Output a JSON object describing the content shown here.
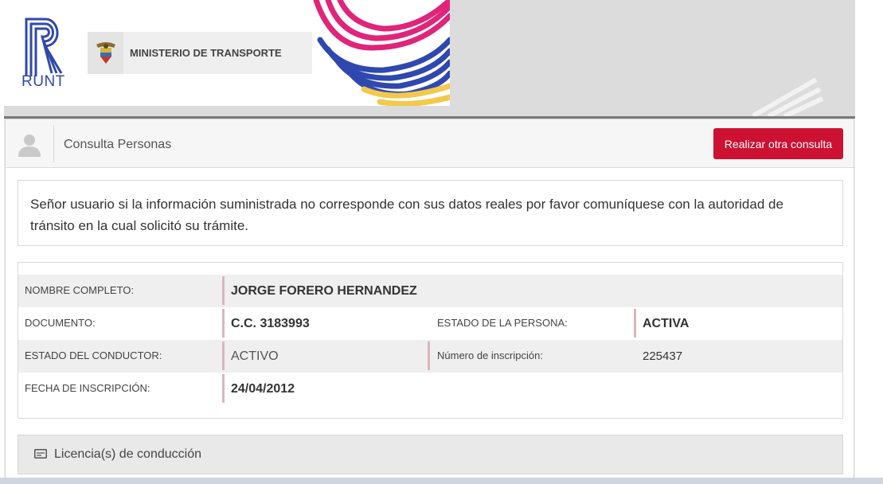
{
  "header": {
    "logo_text": "RUNT",
    "ministry_name": "MINISTERIO DE TRANSPORTE"
  },
  "panel": {
    "title": "Consulta Personas",
    "requery_button": "Realizar otra consulta"
  },
  "notice": {
    "text": "Señor usuario si la información suministrada no corresponde con sus datos reales por favor comuníquese con la autoridad de tránsito en la cual solicitó su trámite."
  },
  "person": {
    "full_name_label": "NOMBRE COMPLETO:",
    "full_name": "JORGE FORERO HERNANDEZ",
    "document_label": "DOCUMENTO:",
    "document": "C.C. 3183993",
    "person_status_label": "ESTADO DE LA PERSONA:",
    "person_status": "ACTIVA",
    "driver_status_label": "ESTADO DEL CONDUCTOR:",
    "driver_status": "ACTIVO",
    "registration_number_label": "Número de inscripción:",
    "registration_number": "225437",
    "registration_date_label": "FECHA DE INSCRIPCIÓN:",
    "registration_date": "24/04/2012"
  },
  "licenses": {
    "title": "Licencia(s) de conducción"
  },
  "colors": {
    "accent_red": "#cc1132",
    "runt_blue": "#3149a8",
    "value_bar": "#d7b8bd"
  }
}
